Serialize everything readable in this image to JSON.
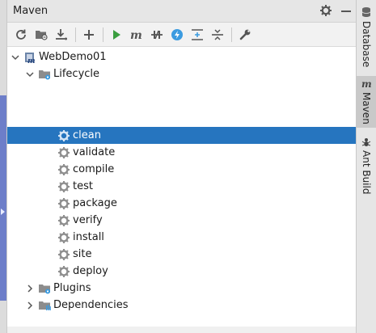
{
  "window": {
    "title": "Maven"
  },
  "toolbar": {
    "buttons": [
      "reload-icon",
      "generate-sources-icon",
      "download-icon",
      "add-icon",
      "run-icon",
      "execute-goal-icon",
      "toggle-offline-icon",
      "skip-tests-icon",
      "show-dependencies-icon",
      "collapse-all-icon",
      "settings-wrench-icon"
    ]
  },
  "tree": {
    "project": "WebDemo01",
    "lifecycle": "Lifecycle",
    "goals": [
      "clean",
      "validate",
      "compile",
      "test",
      "package",
      "verify",
      "install",
      "site",
      "deploy"
    ],
    "selected": "clean",
    "plugins": "Plugins",
    "dependencies": "Dependencies"
  },
  "side_tabs": [
    "Database",
    "Maven",
    "Ant Build"
  ],
  "colors": {
    "selection": "#2675bf",
    "run_green": "#3a9e3f",
    "blue_badge": "#3b9be0"
  }
}
